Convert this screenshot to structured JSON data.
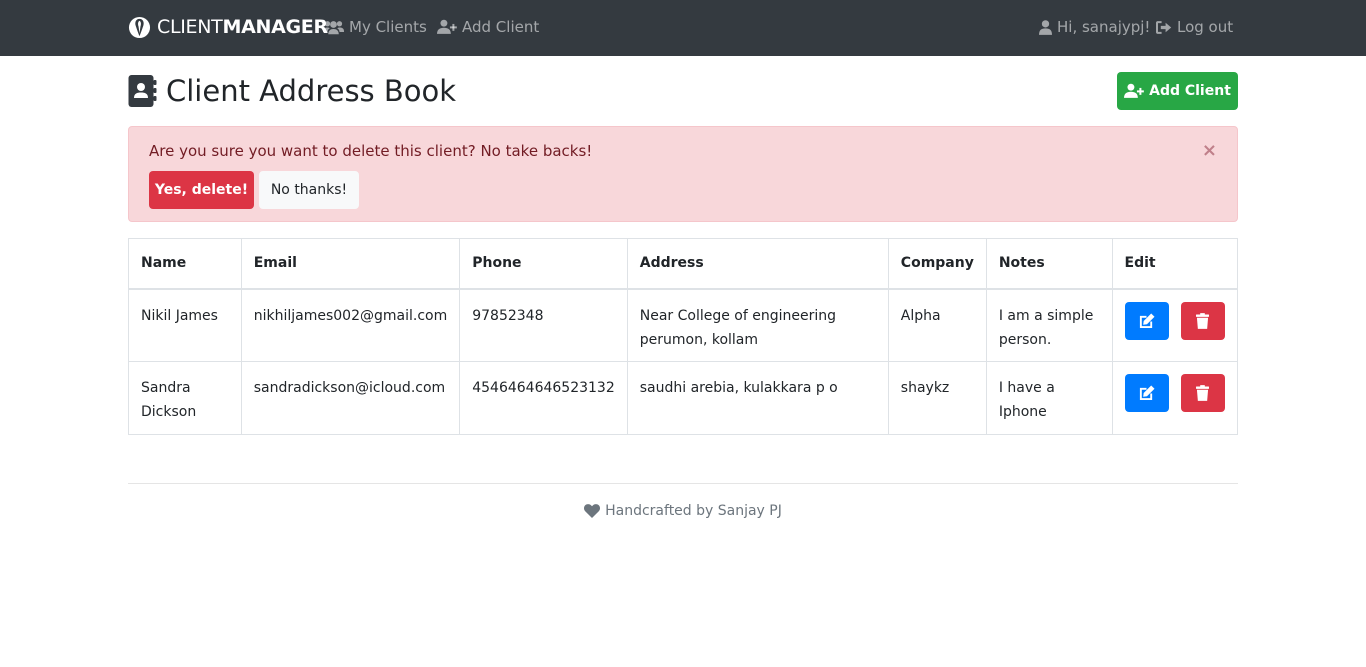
{
  "navbar": {
    "brand_light": "CLIENT",
    "brand_bold": "MANAGER",
    "my_clients": "My Clients",
    "add_client": "Add Client",
    "greeting": "Hi, sanajypj!",
    "logout": "Log out"
  },
  "page": {
    "title": "Client Address Book",
    "add_button": "Add Client"
  },
  "alert": {
    "message": "Are you sure you want to delete this client? No take backs!",
    "close": "×",
    "confirm_label": "Yes, delete!",
    "cancel_label": "No thanks!"
  },
  "table": {
    "headers": [
      "Name",
      "Email",
      "Phone",
      "Address",
      "Company",
      "Notes",
      "Edit"
    ],
    "rows": [
      {
        "name": "Nikil James",
        "email": "nikhiljames002@gmail.com",
        "phone": "97852348",
        "address": "Near College of engineering perumon, kollam",
        "company": "Alpha",
        "notes": "I am a simple person."
      },
      {
        "name": "Sandra Dickson",
        "email": "sandradickson@icloud.com",
        "phone": "4546464646523132",
        "address": "saudhi arebia, kulakkara p o",
        "company": "shaykz",
        "notes": "I have a Iphone"
      }
    ]
  },
  "footer": {
    "text": "Handcrafted by Sanjay PJ"
  },
  "icons": {
    "brand": "brand-logo-icon",
    "my_clients": "users-icon",
    "add_client": "user-plus-icon",
    "user": "user-icon",
    "logout": "sign-out-icon",
    "title": "address-book-icon",
    "edit": "edit-icon",
    "delete": "trash-icon",
    "footer": "heart-icon"
  },
  "colors": {
    "navbar": "#343a40",
    "success": "#28a745",
    "danger": "#dc3545",
    "primary": "#007bff",
    "alert_bg": "#f8d7da",
    "alert_text": "#721c24"
  }
}
